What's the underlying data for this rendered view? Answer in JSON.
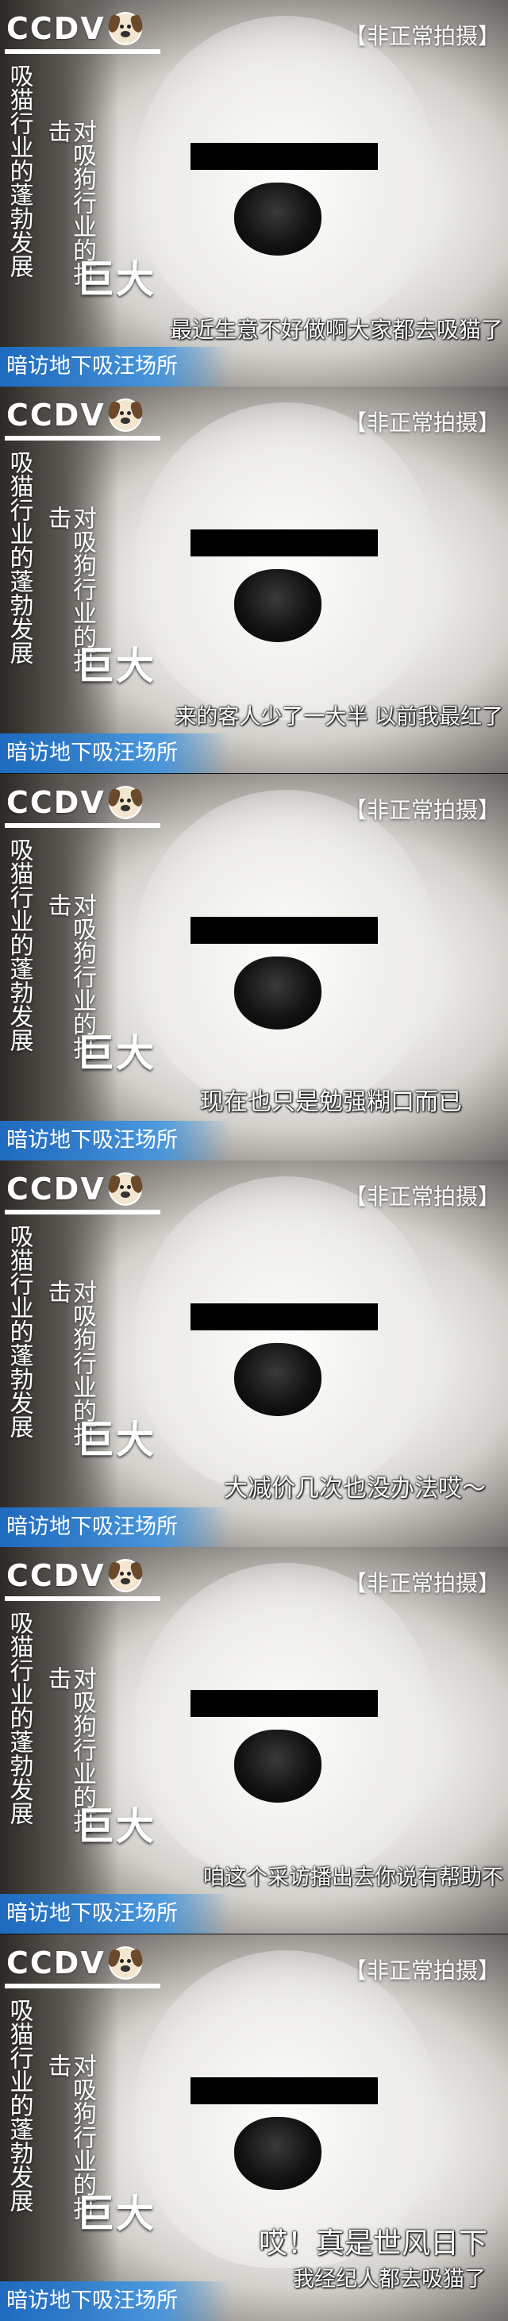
{
  "brand": {
    "logo_text": "CCDV",
    "logo_icon": "dog-face-icon"
  },
  "overlays": {
    "tag": "【非正常拍摄】",
    "vertical_left": "吸猫行业的蓬勃发展",
    "vertical_right": "对吸狗行业的打击",
    "big_label": "巨大",
    "bottom_bar": "暗访地下吸汪场所"
  },
  "panels": [
    {
      "subtitle_lines": [
        "最近生意不好做啊大家都去吸猫了"
      ]
    },
    {
      "subtitle_lines": [
        "来的客人少了一大半 以前我最红了"
      ]
    },
    {
      "subtitle_lines": [
        "现在也只是勉强糊口而已"
      ]
    },
    {
      "subtitle_lines": [
        "大减价几次也没办法哎～"
      ]
    },
    {
      "subtitle_lines": [
        "咱这个采访播出去你说有帮助不"
      ]
    },
    {
      "subtitle_lines": [
        "哎！真是世风日下",
        "我经纪人都去吸猫了"
      ]
    }
  ],
  "colors": {
    "bottom_bar": "#1e6ec8",
    "censor_bar": "#000000",
    "text": "#ffffff"
  }
}
